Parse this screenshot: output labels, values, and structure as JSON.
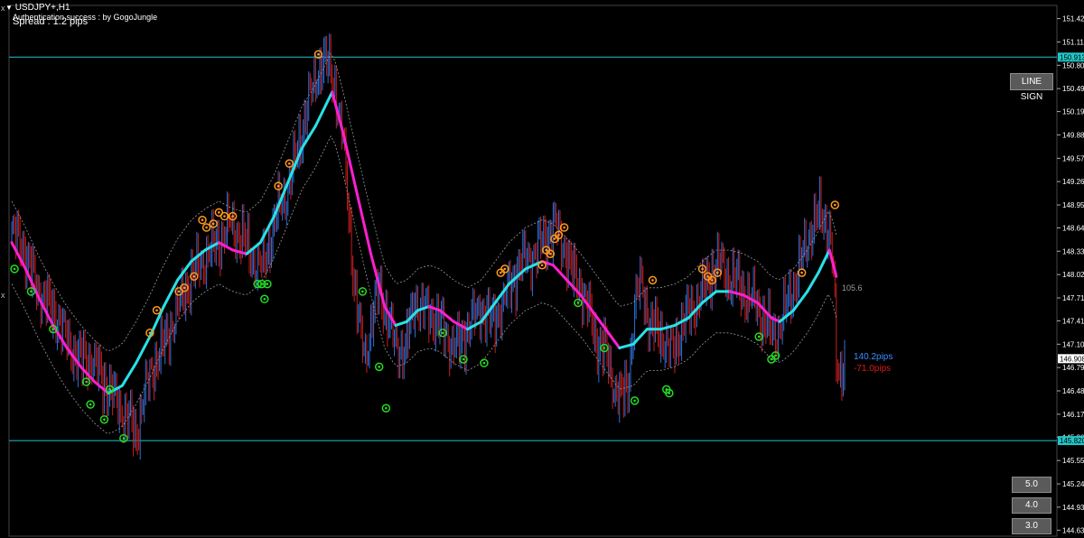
{
  "header": {
    "symbol": "USDJPY+,H1",
    "auth_text": "Authentication success : by GogoJungle",
    "spread_text": "Spread : 1.2 pips"
  },
  "buttons": {
    "line_sign": "LINE SIGN",
    "b50": "5.0",
    "b40": "4.0",
    "b30": "3.0"
  },
  "edge_marks": [
    "x",
    "x"
  ],
  "colors": {
    "background": "#000000",
    "bull_candle": "#2f6fd6",
    "bear_candle": "#c81e1e",
    "ma_rising": "#27e2e6",
    "ma_falling": "#ff1fd0",
    "hline": "#22c6c6",
    "sell_sign": "#ff9a1a",
    "buy_sign": "#22dd22",
    "price_label_bg": "#ffffff",
    "hline_label_bg": "#22c6c6"
  },
  "chart_data": {
    "type": "candlestick",
    "symbol": "USDJPY+",
    "timeframe": "H1",
    "ylim": [
      144.55,
      151.6
    ],
    "y_ticks": [
      "151.425",
      "151.115",
      "150.805",
      "150.495",
      "150.190",
      "149.880",
      "149.570",
      "149.260",
      "148.950",
      "148.645",
      "148.335",
      "148.025",
      "147.715",
      "147.410",
      "147.100",
      "146.790",
      "146.480",
      "146.170",
      "145.865",
      "145.555",
      "145.245",
      "144.935",
      "144.630"
    ],
    "current_price": 146.908,
    "current_price_label": "146.908",
    "horizontal_lines": [
      {
        "value": 150.913,
        "label": "150.913"
      },
      {
        "value": 145.82,
        "label": "145.820"
      }
    ],
    "pips_up": "140.2pips",
    "pips_down": "-71.0pips",
    "band_label": "105.6",
    "close_path": [
      [
        0,
        148.6
      ],
      [
        8,
        148.4
      ],
      [
        14,
        148.05
      ],
      [
        20,
        147.85
      ],
      [
        28,
        147.55
      ],
      [
        35,
        147.4
      ],
      [
        42,
        147.1
      ],
      [
        50,
        146.85
      ],
      [
        58,
        146.95
      ],
      [
        66,
        146.6
      ],
      [
        74,
        146.4
      ],
      [
        80,
        146.25
      ],
      [
        86,
        146.05
      ],
      [
        90,
        145.85
      ],
      [
        96,
        146.45
      ],
      [
        103,
        146.85
      ],
      [
        110,
        147.05
      ],
      [
        117,
        147.45
      ],
      [
        124,
        147.75
      ],
      [
        131,
        148.0
      ],
      [
        138,
        148.25
      ],
      [
        145,
        148.35
      ],
      [
        152,
        148.5
      ],
      [
        158,
        148.75
      ],
      [
        164,
        148.55
      ],
      [
        170,
        148.4
      ],
      [
        176,
        148.2
      ],
      [
        182,
        148.15
      ],
      [
        188,
        148.55
      ],
      [
        194,
        148.95
      ],
      [
        200,
        149.2
      ],
      [
        205,
        149.5
      ],
      [
        210,
        149.9
      ],
      [
        215,
        150.35
      ],
      [
        220,
        150.65
      ],
      [
        225,
        150.85
      ],
      [
        230,
        150.75
      ],
      [
        234,
        150.55
      ],
      [
        240,
        149.8
      ],
      [
        244,
        148.85
      ],
      [
        248,
        147.85
      ],
      [
        252,
        147.25
      ],
      [
        256,
        147.0
      ],
      [
        260,
        147.35
      ],
      [
        266,
        147.85
      ],
      [
        272,
        147.45
      ],
      [
        278,
        147.1
      ],
      [
        285,
        147.0
      ],
      [
        292,
        147.7
      ],
      [
        300,
        147.55
      ],
      [
        308,
        147.4
      ],
      [
        316,
        147.2
      ],
      [
        324,
        147.05
      ],
      [
        332,
        147.4
      ],
      [
        340,
        147.6
      ],
      [
        348,
        147.35
      ],
      [
        356,
        147.7
      ],
      [
        364,
        148.0
      ],
      [
        372,
        148.25
      ],
      [
        380,
        148.35
      ],
      [
        388,
        148.55
      ],
      [
        394,
        148.7
      ],
      [
        400,
        148.4
      ],
      [
        406,
        148.0
      ],
      [
        412,
        147.9
      ],
      [
        418,
        147.55
      ],
      [
        424,
        147.1
      ],
      [
        430,
        147.0
      ],
      [
        436,
        146.6
      ],
      [
        441,
        146.35
      ],
      [
        446,
        146.55
      ],
      [
        452,
        147.7
      ],
      [
        456,
        148.0
      ],
      [
        462,
        147.3
      ],
      [
        470,
        147.25
      ],
      [
        478,
        147.0
      ],
      [
        486,
        147.35
      ],
      [
        494,
        147.65
      ],
      [
        502,
        147.85
      ],
      [
        508,
        148.1
      ],
      [
        514,
        148.2
      ],
      [
        520,
        147.95
      ],
      [
        526,
        147.9
      ],
      [
        532,
        147.75
      ],
      [
        538,
        147.7
      ],
      [
        544,
        147.4
      ],
      [
        550,
        147.25
      ],
      [
        556,
        147.35
      ],
      [
        562,
        147.65
      ],
      [
        568,
        147.95
      ],
      [
        574,
        148.4
      ],
      [
        580,
        148.7
      ],
      [
        586,
        148.8
      ],
      [
        592,
        148.65
      ],
      [
        595,
        148.1
      ],
      [
        597,
        146.8
      ],
      [
        600,
        146.7
      ],
      [
        603,
        146.95
      ]
    ],
    "ma_path": [
      [
        0,
        148.45
      ],
      [
        10,
        148.1
      ],
      [
        20,
        147.7
      ],
      [
        30,
        147.35
      ],
      [
        40,
        147.05
      ],
      [
        50,
        146.8
      ],
      [
        60,
        146.6
      ],
      [
        70,
        146.45
      ],
      [
        80,
        146.55
      ],
      [
        90,
        146.85
      ],
      [
        100,
        147.2
      ],
      [
        110,
        147.6
      ],
      [
        120,
        147.95
      ],
      [
        130,
        148.2
      ],
      [
        140,
        148.35
      ],
      [
        150,
        148.45
      ],
      [
        160,
        148.35
      ],
      [
        170,
        148.3
      ],
      [
        180,
        148.45
      ],
      [
        190,
        148.8
      ],
      [
        200,
        149.25
      ],
      [
        210,
        149.7
      ],
      [
        220,
        150.0
      ],
      [
        232,
        150.45
      ],
      [
        240,
        149.9
      ],
      [
        250,
        149.1
      ],
      [
        260,
        148.3
      ],
      [
        270,
        147.6
      ],
      [
        278,
        147.35
      ],
      [
        286,
        147.4
      ],
      [
        294,
        147.55
      ],
      [
        302,
        147.6
      ],
      [
        310,
        147.55
      ],
      [
        320,
        147.4
      ],
      [
        330,
        147.3
      ],
      [
        340,
        147.4
      ],
      [
        350,
        147.65
      ],
      [
        360,
        147.9
      ],
      [
        372,
        148.1
      ],
      [
        384,
        148.2
      ],
      [
        392,
        148.15
      ],
      [
        402,
        147.95
      ],
      [
        412,
        147.75
      ],
      [
        422,
        147.5
      ],
      [
        432,
        147.25
      ],
      [
        440,
        147.05
      ],
      [
        450,
        147.1
      ],
      [
        460,
        147.3
      ],
      [
        470,
        147.3
      ],
      [
        480,
        147.35
      ],
      [
        490,
        147.45
      ],
      [
        500,
        147.65
      ],
      [
        510,
        147.8
      ],
      [
        520,
        147.8
      ],
      [
        530,
        147.75
      ],
      [
        540,
        147.65
      ],
      [
        550,
        147.45
      ],
      [
        556,
        147.4
      ],
      [
        566,
        147.55
      ],
      [
        576,
        147.8
      ],
      [
        584,
        148.05
      ],
      [
        592,
        148.35
      ],
      [
        597,
        148.0
      ]
    ],
    "band_width": 0.55,
    "sell_signals": [
      [
        138,
        148.75
      ],
      [
        141,
        148.65
      ],
      [
        146,
        148.7
      ],
      [
        150,
        148.85
      ],
      [
        154,
        148.8
      ],
      [
        160,
        148.8
      ],
      [
        132,
        148.0
      ],
      [
        125,
        147.85
      ],
      [
        121,
        147.8
      ],
      [
        105,
        147.55
      ],
      [
        100,
        147.25
      ],
      [
        193,
        149.2
      ],
      [
        201,
        149.5
      ],
      [
        222,
        150.95
      ],
      [
        354,
        148.05
      ],
      [
        357,
        148.1
      ],
      [
        384,
        148.15
      ],
      [
        387,
        148.35
      ],
      [
        390,
        148.3
      ],
      [
        393,
        148.5
      ],
      [
        396,
        148.55
      ],
      [
        400,
        148.65
      ],
      [
        464,
        147.95
      ],
      [
        500,
        148.1
      ],
      [
        504,
        148.0
      ],
      [
        507,
        147.95
      ],
      [
        511,
        148.05
      ],
      [
        572,
        148.05
      ],
      [
        596,
        148.95
      ]
    ],
    "buy_signals": [
      [
        2,
        148.1
      ],
      [
        14,
        147.8
      ],
      [
        30,
        147.3
      ],
      [
        54,
        146.6
      ],
      [
        57,
        146.3
      ],
      [
        71,
        146.5
      ],
      [
        67,
        146.1
      ],
      [
        81,
        145.85
      ],
      [
        178,
        147.9
      ],
      [
        181,
        147.9
      ],
      [
        185,
        147.9
      ],
      [
        183,
        147.7
      ],
      [
        254,
        147.8
      ],
      [
        266,
        146.8
      ],
      [
        271,
        146.25
      ],
      [
        312,
        147.25
      ],
      [
        327,
        146.9
      ],
      [
        342,
        146.85
      ],
      [
        410,
        147.65
      ],
      [
        429,
        147.05
      ],
      [
        451,
        146.35
      ],
      [
        474,
        146.5
      ],
      [
        476,
        146.45
      ],
      [
        541,
        147.2
      ],
      [
        550,
        146.9
      ],
      [
        553,
        146.95
      ]
    ]
  }
}
